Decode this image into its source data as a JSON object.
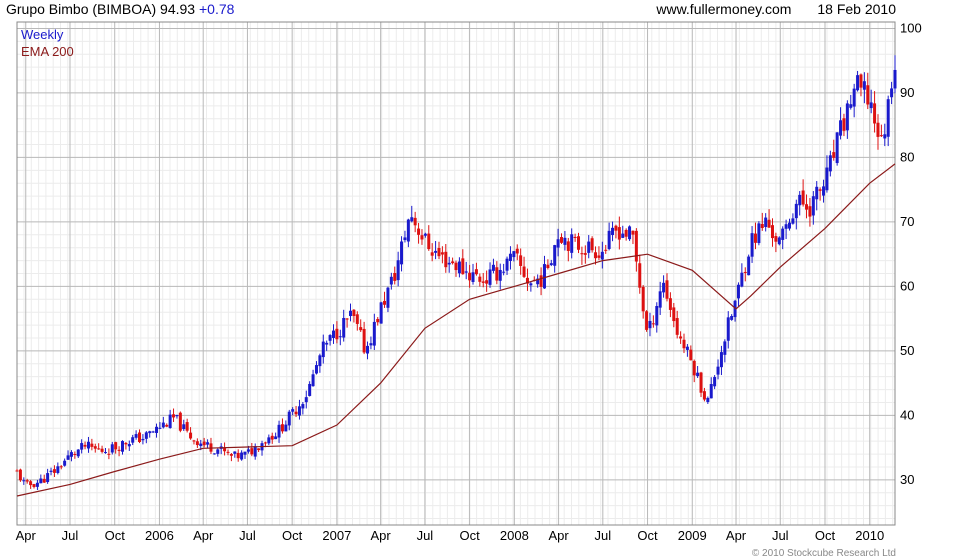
{
  "header": {
    "ticker": "Grupo Bimbo (BIMBOA)",
    "price": "94.93",
    "change": "+0.78",
    "site": "www.fullermoney.com",
    "date": "18 Feb 2010"
  },
  "legend": {
    "weekly_label": "Weekly",
    "ema_label": "EMA 200",
    "weekly_color": "#1a1acc",
    "ema_color": "#8b1a1a"
  },
  "copyright": "© 2010 Stockcube Research Ltd",
  "chart_data": {
    "type": "candlestick",
    "title": "Grupo Bimbo (BIMBOA) 94.93 +0.78",
    "y_axis_position": "right",
    "ylim": [
      23,
      101
    ],
    "y_ticks": [
      30,
      40,
      50,
      60,
      70,
      80,
      90,
      100
    ],
    "x_range": [
      "2005-03-14",
      "2010-02-22"
    ],
    "x_ticks": [
      {
        "label": "Apr",
        "date": "2005-04-01"
      },
      {
        "label": "Jul",
        "date": "2005-07-01"
      },
      {
        "label": "Oct",
        "date": "2005-10-01"
      },
      {
        "label": "2006",
        "date": "2006-01-01"
      },
      {
        "label": "Apr",
        "date": "2006-04-01"
      },
      {
        "label": "Jul",
        "date": "2006-07-01"
      },
      {
        "label": "Oct",
        "date": "2006-10-01"
      },
      {
        "label": "2007",
        "date": "2007-01-01"
      },
      {
        "label": "Apr",
        "date": "2007-04-01"
      },
      {
        "label": "Jul",
        "date": "2007-07-01"
      },
      {
        "label": "Oct",
        "date": "2007-10-01"
      },
      {
        "label": "2008",
        "date": "2008-01-01"
      },
      {
        "label": "Apr",
        "date": "2008-04-01"
      },
      {
        "label": "Jul",
        "date": "2008-07-01"
      },
      {
        "label": "Oct",
        "date": "2008-10-01"
      },
      {
        "label": "2009",
        "date": "2009-01-01"
      },
      {
        "label": "Apr",
        "date": "2009-04-01"
      },
      {
        "label": "Jul",
        "date": "2009-07-01"
      },
      {
        "label": "Oct",
        "date": "2009-10-01"
      },
      {
        "label": "2010",
        "date": "2010-01-01"
      }
    ],
    "grid": true,
    "up_color": "#1a1acc",
    "down_color": "#dd1111",
    "ema_color": "#8b1a1a",
    "weekly_close_path": [
      [
        "2005-03-14",
        31.2
      ],
      [
        "2005-04-01",
        29.0
      ],
      [
        "2005-05-01",
        29.8
      ],
      [
        "2005-06-01",
        31.5
      ],
      [
        "2005-07-01",
        33.8
      ],
      [
        "2005-08-01",
        35.2
      ],
      [
        "2005-09-01",
        34.5
      ],
      [
        "2005-10-01",
        35.0
      ],
      [
        "2005-11-01",
        36.2
      ],
      [
        "2005-12-01",
        36.6
      ],
      [
        "2006-01-01",
        38.2
      ],
      [
        "2006-02-01",
        39.6
      ],
      [
        "2006-03-01",
        37.0
      ],
      [
        "2006-04-01",
        35.5
      ],
      [
        "2006-05-01",
        34.8
      ],
      [
        "2006-06-01",
        33.5
      ],
      [
        "2006-07-01",
        34.0
      ],
      [
        "2006-08-01",
        36.0
      ],
      [
        "2006-09-01",
        37.5
      ],
      [
        "2006-10-01",
        40.2
      ],
      [
        "2006-11-01",
        43.5
      ],
      [
        "2006-12-01",
        50.0
      ],
      [
        "2007-01-01",
        53.0
      ],
      [
        "2007-02-01",
        55.5
      ],
      [
        "2007-03-01",
        50.0
      ],
      [
        "2007-04-01",
        56.5
      ],
      [
        "2007-05-01",
        62.0
      ],
      [
        "2007-06-01",
        71.5
      ],
      [
        "2007-07-01",
        67.0
      ],
      [
        "2007-08-01",
        64.5
      ],
      [
        "2007-09-01",
        63.5
      ],
      [
        "2007-10-01",
        62.0
      ],
      [
        "2007-11-01",
        61.0
      ],
      [
        "2007-12-01",
        62.5
      ],
      [
        "2008-01-01",
        64.5
      ],
      [
        "2008-02-01",
        60.5
      ],
      [
        "2008-03-01",
        61.5
      ],
      [
        "2008-04-01",
        68.5
      ],
      [
        "2008-05-01",
        66.5
      ],
      [
        "2008-06-01",
        66.0
      ],
      [
        "2008-07-01",
        65.5
      ],
      [
        "2008-08-01",
        69.0
      ],
      [
        "2008-09-01",
        67.5
      ],
      [
        "2008-10-01",
        52.0
      ],
      [
        "2008-11-01",
        61.0
      ],
      [
        "2008-12-01",
        53.0
      ],
      [
        "2009-01-01",
        48.0
      ],
      [
        "2009-02-01",
        42.0
      ],
      [
        "2009-03-01",
        50.0
      ],
      [
        "2009-04-01",
        58.0
      ],
      [
        "2009-05-01",
        67.0
      ],
      [
        "2009-06-01",
        70.0
      ],
      [
        "2009-07-01",
        66.5
      ],
      [
        "2009-08-01",
        73.0
      ],
      [
        "2009-09-01",
        72.5
      ],
      [
        "2009-10-01",
        76.0
      ],
      [
        "2009-11-01",
        83.5
      ],
      [
        "2009-12-01",
        91.0
      ],
      [
        "2010-01-01",
        89.0
      ],
      [
        "2010-01-25",
        82.0
      ],
      [
        "2010-02-08",
        88.0
      ],
      [
        "2010-02-18",
        94.93
      ]
    ],
    "ema200_path": [
      [
        "2005-03-14",
        27.5
      ],
      [
        "2005-07-01",
        29.3
      ],
      [
        "2005-10-01",
        31.3
      ],
      [
        "2006-01-01",
        33.2
      ],
      [
        "2006-04-01",
        34.9
      ],
      [
        "2006-07-01",
        35.1
      ],
      [
        "2006-10-01",
        35.3
      ],
      [
        "2007-01-01",
        38.5
      ],
      [
        "2007-04-01",
        45.0
      ],
      [
        "2007-07-01",
        53.5
      ],
      [
        "2007-10-01",
        58.0
      ],
      [
        "2008-01-01",
        60.0
      ],
      [
        "2008-04-01",
        62.0
      ],
      [
        "2008-07-01",
        64.0
      ],
      [
        "2008-10-01",
        65.0
      ],
      [
        "2009-01-01",
        62.5
      ],
      [
        "2009-04-01",
        56.5
      ],
      [
        "2009-05-01",
        58.5
      ],
      [
        "2009-07-01",
        63.0
      ],
      [
        "2009-10-01",
        69.0
      ],
      [
        "2010-01-01",
        76.0
      ],
      [
        "2010-02-22",
        79.0
      ]
    ]
  }
}
